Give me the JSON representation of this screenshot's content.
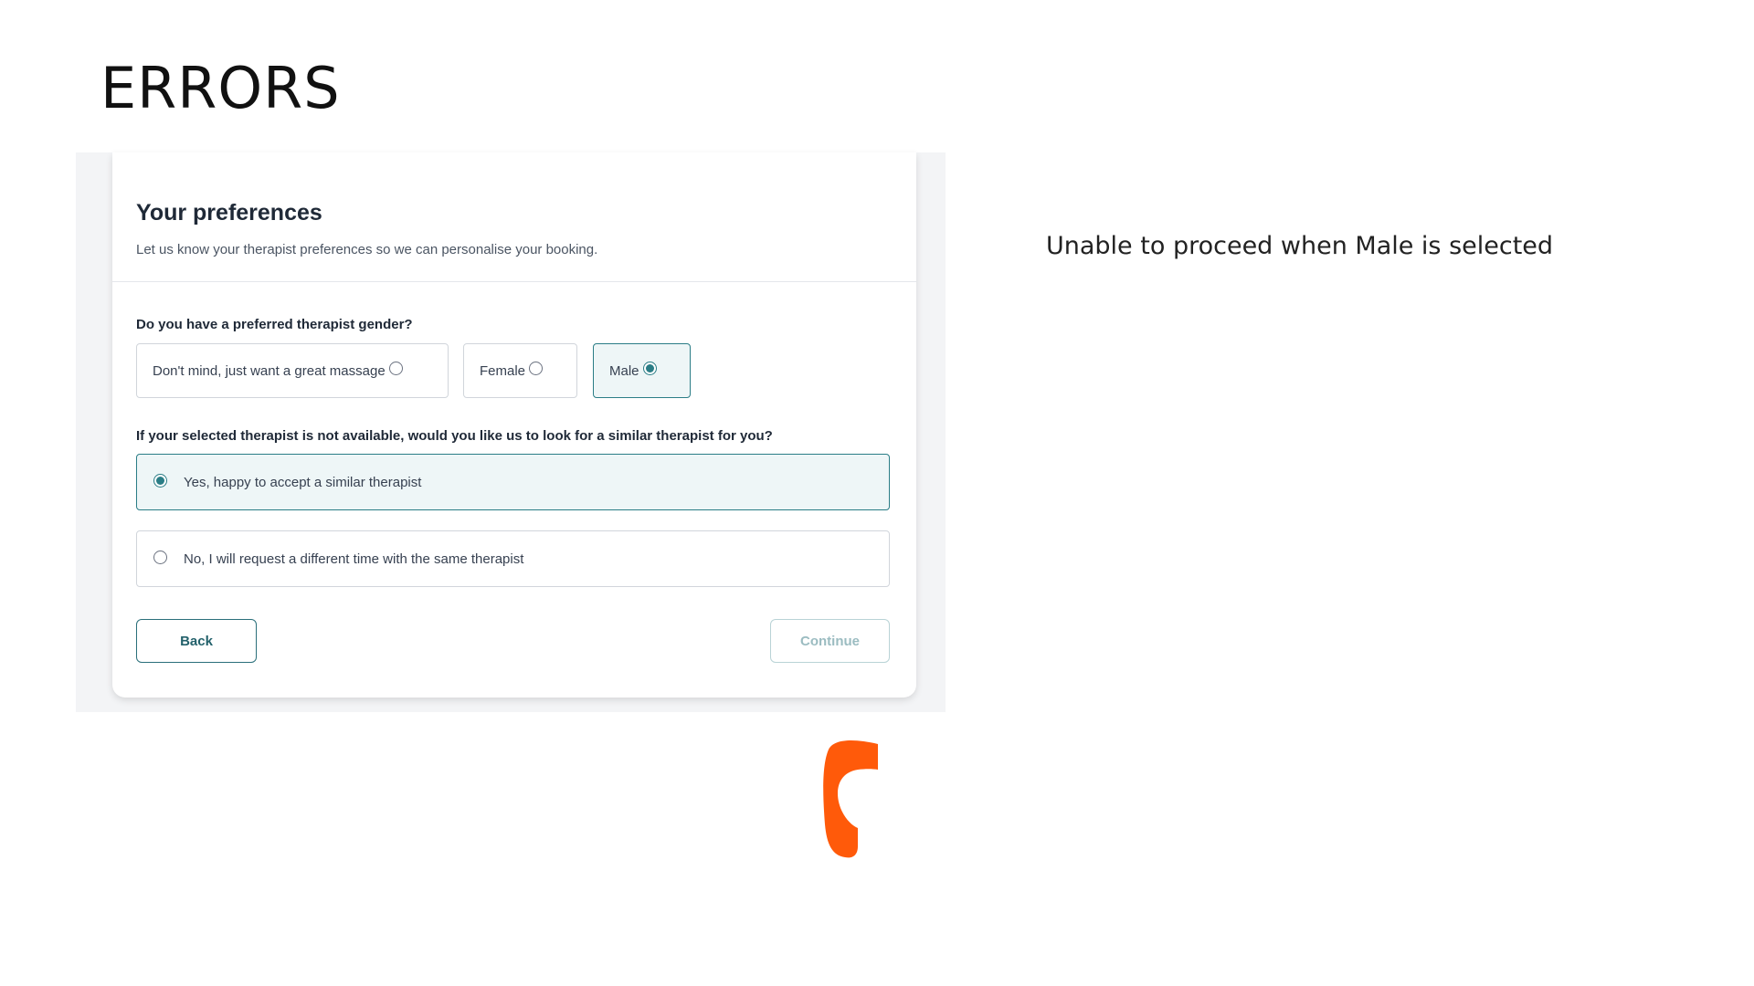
{
  "slide": {
    "title": "ERRORS",
    "annotation": "Unable to proceed when Male is selected"
  },
  "form": {
    "title": "Your preferences",
    "subtitle": "Let us know your therapist preferences so we can personalise your booking.",
    "gender_question": "Do you have a preferred therapist gender?",
    "gender_options": [
      {
        "label": "Don't mind, just want a great massage",
        "selected": false
      },
      {
        "label": "Female",
        "selected": false
      },
      {
        "label": "Male",
        "selected": true
      }
    ],
    "availability_question": "If your selected therapist is not available, would you like us to look for a similar therapist for you?",
    "availability_options": [
      {
        "label": "Yes, happy to accept a similar therapist",
        "selected": true
      },
      {
        "label": "No, I will request a different time with the same therapist",
        "selected": false
      }
    ],
    "back_label": "Back",
    "continue_label": "Continue",
    "continue_disabled": true
  },
  "colors": {
    "accent": "#2a7d86",
    "selected_bg": "#eef6f7",
    "annotation_mark": "#ff5a0a"
  }
}
